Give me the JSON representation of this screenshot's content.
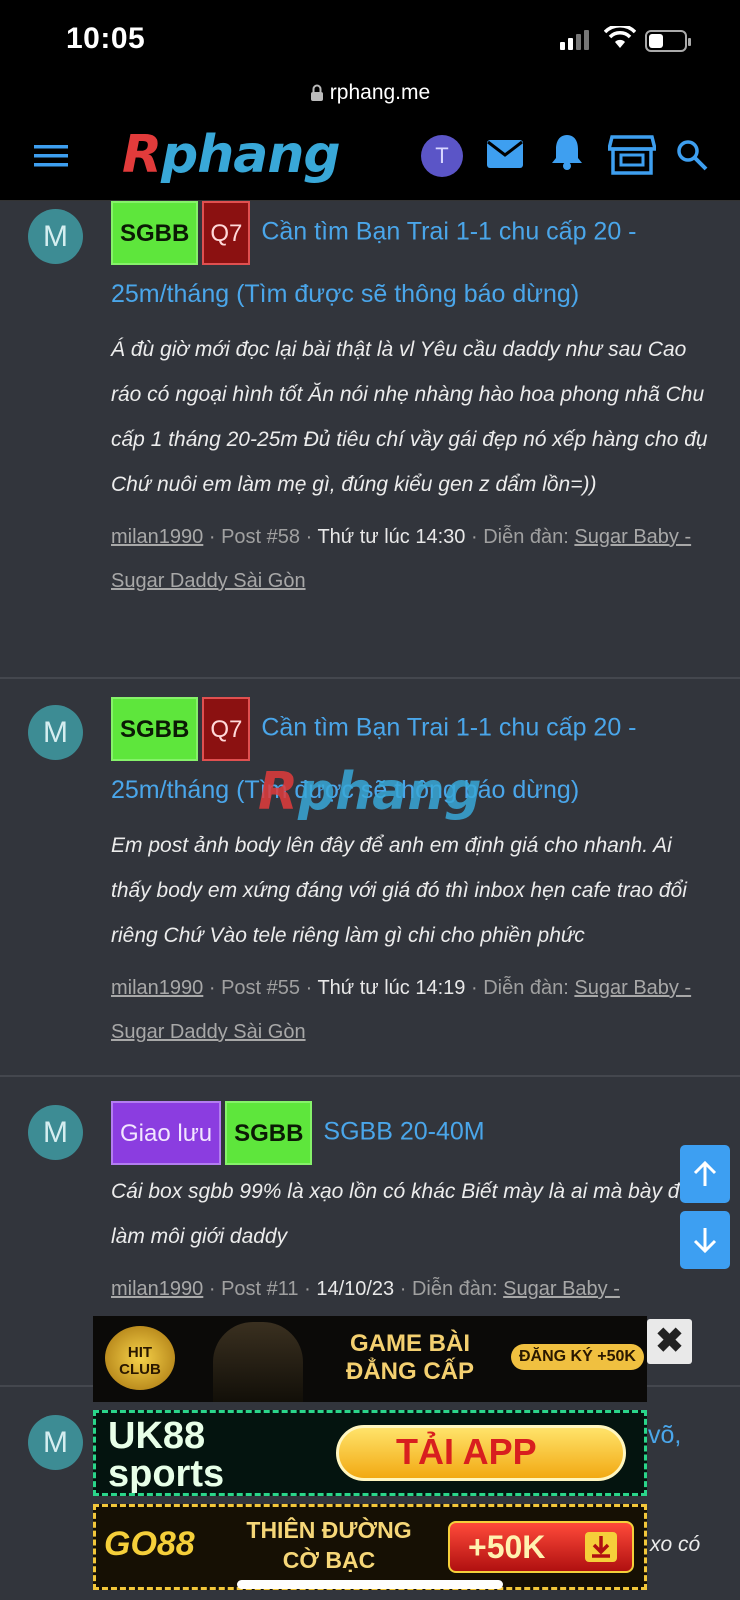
{
  "status": {
    "time": "10:05"
  },
  "browser": {
    "url": "rphang.me"
  },
  "header": {
    "logo_r": "R",
    "logo_rest": "phang",
    "avatar_letter": "T"
  },
  "posts": [
    {
      "avatar": "M",
      "tags": [
        "SGBB",
        "Q7"
      ],
      "title": "Cần tìm Bạn Trai 1-1 chu cấp 20 - 25m/tháng (Tìm được sẽ thông báo dừng)",
      "excerpt": "Á đù giờ mới đọc lại bài thật là vl Yêu cầu daddy như sau Cao ráo có ngoại hình tốt Ăn nói nhẹ nhàng hào hoa phong nhã Chu cấp 1 tháng 20-25m Đủ tiêu chí vầy gái đẹp nó xếp hàng cho đụ Chứ nuôi em làm mẹ gì, đúng kiểu gen z dẩm lồn=))",
      "user": "milan1990",
      "post_no": "Post #58",
      "date": "Thứ tư lúc 14:30",
      "forum_label": "Diễn đàn:",
      "forum": "Sugar Baby - Sugar Daddy Sài Gòn"
    },
    {
      "avatar": "M",
      "tags": [
        "SGBB",
        "Q7"
      ],
      "title": "Cần tìm Bạn Trai 1-1 chu cấp 20 - 25m/tháng (Tìm được sẽ thông báo dừng)",
      "excerpt": "Em post ảnh body lên đây để anh em định giá cho nhanh. Ai thấy body em xứng đáng với giá đó thì inbox hẹn cafe trao đổi riêng Chứ Vào tele riêng làm gì chi cho phiền phức",
      "user": "milan1990",
      "post_no": "Post #55",
      "date": "Thứ tư lúc 14:19",
      "forum_label": "Diễn đàn:",
      "forum": "Sugar Baby - Sugar Daddy Sài Gòn"
    },
    {
      "avatar": "M",
      "tags": [
        "Giao lưu",
        "SGBB"
      ],
      "title": "SGBB 20-40M",
      "excerpt": "Cái box sgbb 99% là xạo lồn có khác Biết mày là ai mà bày đặt làm môi giới daddy",
      "user": "milan1990",
      "post_no": "Post #11",
      "date": "14/10/23",
      "forum_label": "Diễn đàn:",
      "forum": "Sugar Baby -"
    },
    {
      "avatar": "M",
      "title_tail": "võ,",
      "excerpt_tail": "xo có"
    }
  ],
  "ads": [
    {
      "brand": "HIT CLUB",
      "headline": "GAME BÀI ĐẲNG CẤP",
      "cta": "ĐĂNG KÝ +50K"
    },
    {
      "brand": "UK88 sports",
      "cta": "TẢI APP"
    },
    {
      "brand": "GO88",
      "headline": "THIÊN ĐƯỜNG CỜ BẠC",
      "cta": "+50K"
    }
  ],
  "ad_close": "✖"
}
